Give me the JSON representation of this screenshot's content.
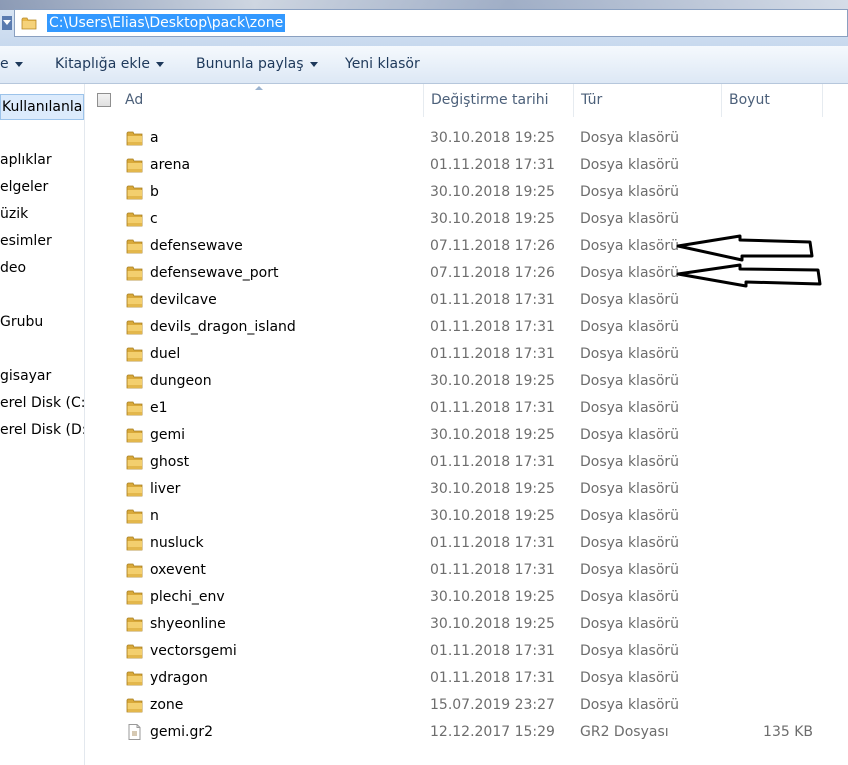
{
  "address": {
    "path": "C:\\Users\\Elias\\Desktop\\pack\\zone"
  },
  "toolbar": {
    "organize_label": "e",
    "library_label": "Kitaplığa ekle",
    "share_label": "Bununla paylaş",
    "new_folder_label": "Yeni klasör"
  },
  "nav": {
    "items": [
      "Kullanılanla",
      "aplıklar",
      "elgeler",
      "üzik",
      "esimler",
      "deo",
      "Grubu",
      "gisayar",
      "erel Disk (C:)",
      "erel Disk (D:)"
    ]
  },
  "columns": {
    "name": "Ad",
    "date": "Değiştirme tarihi",
    "type": "Tür",
    "size": "Boyut"
  },
  "files": [
    {
      "name": "a",
      "date": "30.10.2018 19:25",
      "type": "Dosya klasörü",
      "size": "",
      "kind": "folder"
    },
    {
      "name": "arena",
      "date": "01.11.2018 17:31",
      "type": "Dosya klasörü",
      "size": "",
      "kind": "folder"
    },
    {
      "name": "b",
      "date": "30.10.2018 19:25",
      "type": "Dosya klasörü",
      "size": "",
      "kind": "folder"
    },
    {
      "name": "c",
      "date": "30.10.2018 19:25",
      "type": "Dosya klasörü",
      "size": "",
      "kind": "folder"
    },
    {
      "name": "defensewave",
      "date": "07.11.2018 17:26",
      "type": "Dosya klasörü",
      "size": "",
      "kind": "folder"
    },
    {
      "name": "defensewave_port",
      "date": "07.11.2018 17:26",
      "type": "Dosya klasörü",
      "size": "",
      "kind": "folder"
    },
    {
      "name": "devilcave",
      "date": "01.11.2018 17:31",
      "type": "Dosya klasörü",
      "size": "",
      "kind": "folder"
    },
    {
      "name": "devils_dragon_island",
      "date": "01.11.2018 17:31",
      "type": "Dosya klasörü",
      "size": "",
      "kind": "folder"
    },
    {
      "name": "duel",
      "date": "01.11.2018 17:31",
      "type": "Dosya klasörü",
      "size": "",
      "kind": "folder"
    },
    {
      "name": "dungeon",
      "date": "30.10.2018 19:25",
      "type": "Dosya klasörü",
      "size": "",
      "kind": "folder"
    },
    {
      "name": "e1",
      "date": "01.11.2018 17:31",
      "type": "Dosya klasörü",
      "size": "",
      "kind": "folder"
    },
    {
      "name": "gemi",
      "date": "30.10.2018 19:25",
      "type": "Dosya klasörü",
      "size": "",
      "kind": "folder"
    },
    {
      "name": "ghost",
      "date": "01.11.2018 17:31",
      "type": "Dosya klasörü",
      "size": "",
      "kind": "folder"
    },
    {
      "name": "liver",
      "date": "30.10.2018 19:25",
      "type": "Dosya klasörü",
      "size": "",
      "kind": "folder"
    },
    {
      "name": "n",
      "date": "30.10.2018 19:25",
      "type": "Dosya klasörü",
      "size": "",
      "kind": "folder"
    },
    {
      "name": "nusluck",
      "date": "01.11.2018 17:31",
      "type": "Dosya klasörü",
      "size": "",
      "kind": "folder"
    },
    {
      "name": "oxevent",
      "date": "01.11.2018 17:31",
      "type": "Dosya klasörü",
      "size": "",
      "kind": "folder"
    },
    {
      "name": "plechi_env",
      "date": "30.10.2018 19:25",
      "type": "Dosya klasörü",
      "size": "",
      "kind": "folder"
    },
    {
      "name": "shyeonline",
      "date": "30.10.2018 19:25",
      "type": "Dosya klasörü",
      "size": "",
      "kind": "folder"
    },
    {
      "name": "vectorsgemi",
      "date": "01.11.2018 17:31",
      "type": "Dosya klasörü",
      "size": "",
      "kind": "folder"
    },
    {
      "name": "ydragon",
      "date": "01.11.2018 17:31",
      "type": "Dosya klasörü",
      "size": "",
      "kind": "folder"
    },
    {
      "name": "zone",
      "date": "15.07.2019 23:27",
      "type": "Dosya klasörü",
      "size": "",
      "kind": "folder"
    },
    {
      "name": "gemi.gr2",
      "date": "12.12.2017 15:29",
      "type": "GR2 Dosyası",
      "size": "135 KB",
      "kind": "file"
    }
  ],
  "colors": {
    "selection": "#3399ff",
    "folder": "#e8b84a",
    "toolbar_text": "#1e395b"
  },
  "icons": {
    "folder": "folder-icon",
    "file": "file-icon",
    "annotation": "arrow-icon"
  }
}
